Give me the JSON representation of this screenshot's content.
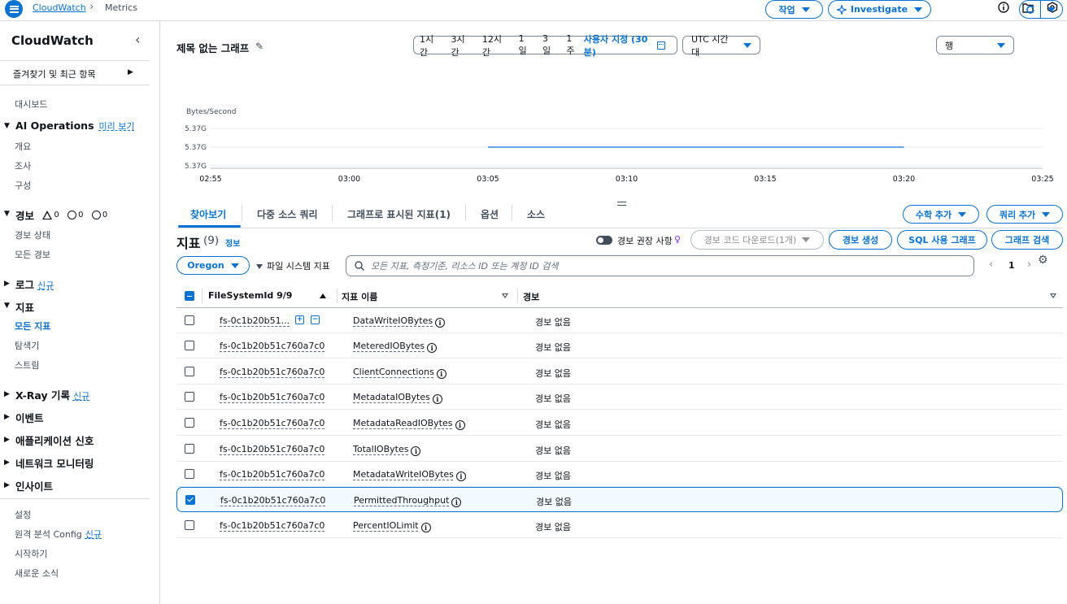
{
  "topbar": {
    "breadcrumb_link": "CloudWatch",
    "breadcrumb_current": "Metrics"
  },
  "sidebar": {
    "title": "CloudWatch",
    "favorites": "즐겨찾기 및 최근 항목",
    "dashboards": "대시보드",
    "ai_ops": {
      "label": "AI Operations",
      "preview": "미리 보기",
      "items": [
        "개요",
        "조사",
        "구성"
      ]
    },
    "alarms": {
      "label": "경보",
      "counts": [
        "0",
        "0",
        "0"
      ],
      "items": [
        "경보 상태",
        "모든 경보"
      ]
    },
    "logs": {
      "label": "로그",
      "badge": "신규"
    },
    "metrics": {
      "label": "지표",
      "items": [
        "모든 지표",
        "탐색기",
        "스트림"
      ]
    },
    "xray": {
      "label": "X-Ray 기록",
      "badge": "신규"
    },
    "events": "이벤트",
    "app_signals": "애플리케이션 신호",
    "network": "네트워크 모니터링",
    "insights": "인사이트",
    "bottom": {
      "settings": "설정",
      "telemetry": "원격 분석 Config",
      "telemetry_badge": "신규",
      "getting_started": "시작하기",
      "whats_new": "새로운 소식"
    }
  },
  "header": {
    "graph_title": "제목 없는 그래프",
    "time_ranges": [
      "1시간",
      "3시간",
      "12시간",
      "1일",
      "3일",
      "1주"
    ],
    "custom_range": "사용자 지정 (30분)",
    "timezone": "UTC 시간대",
    "actions": "작업",
    "investigate": "Investigate",
    "view": "행"
  },
  "chart_data": {
    "type": "line",
    "ylabel": "Bytes/Second",
    "y_ticks": [
      "5.37G",
      "5.37G",
      "5.37G"
    ],
    "x_ticks": [
      "02:55",
      "03:00",
      "03:05",
      "03:10",
      "03:15",
      "03:20",
      "03:25"
    ],
    "series": [
      {
        "x": [
          "03:05",
          "03:20"
        ],
        "values": [
          5.37,
          5.37
        ],
        "unit": "G",
        "color": "#0972d3"
      }
    ],
    "grid": true
  },
  "tabs": [
    "찾아보기",
    "다중 소스 쿼리",
    "그래프로 표시된 지표(1)",
    "옵션",
    "소스"
  ],
  "tab_actions": {
    "math": "수학 추가",
    "query": "쿼리 추가"
  },
  "metrics_panel": {
    "title": "지표",
    "count": "(9)",
    "info": "정보",
    "alarm_recs": "경보 권장 사항",
    "download": "경보 코드 다운로드(1개)",
    "create_alarm": "경보 생성",
    "sql_graph": "SQL 사용 그래프",
    "graph_search": "그래프 검색",
    "region": "Oregon",
    "filter": "파일 시스템 지표",
    "search_placeholder": "모든 지표, 측정기준, 리소스 ID 또는 계정 ID 검색",
    "page": "1"
  },
  "table": {
    "headers": [
      "FileSystemId 9/9",
      "지표 이름",
      "경보"
    ],
    "rows": [
      {
        "fsid": "fs-0c1b20b51...",
        "metric": "DataWriteIOBytes",
        "alarm": "경보 없음",
        "checked": false
      },
      {
        "fsid": "fs-0c1b20b51c760a7c0",
        "metric": "MeteredIOBytes",
        "alarm": "경보 없음",
        "checked": false
      },
      {
        "fsid": "fs-0c1b20b51c760a7c0",
        "metric": "ClientConnections",
        "alarm": "경보 없음",
        "checked": false
      },
      {
        "fsid": "fs-0c1b20b51c760a7c0",
        "metric": "MetadataIOBytes",
        "alarm": "경보 없음",
        "checked": false
      },
      {
        "fsid": "fs-0c1b20b51c760a7c0",
        "metric": "MetadataReadIOBytes",
        "alarm": "경보 없음",
        "checked": false
      },
      {
        "fsid": "fs-0c1b20b51c760a7c0",
        "metric": "TotalIOBytes",
        "alarm": "경보 없음",
        "checked": false
      },
      {
        "fsid": "fs-0c1b20b51c760a7c0",
        "metric": "MetadataWriteIOBytes",
        "alarm": "경보 없음",
        "checked": false
      },
      {
        "fsid": "fs-0c1b20b51c760a7c0",
        "metric": "PermittedThroughput",
        "alarm": "경보 없음",
        "checked": true
      },
      {
        "fsid": "fs-0c1b20b51c760a7c0",
        "metric": "PercentIOLimit",
        "alarm": "경보 없음",
        "checked": false
      }
    ]
  }
}
